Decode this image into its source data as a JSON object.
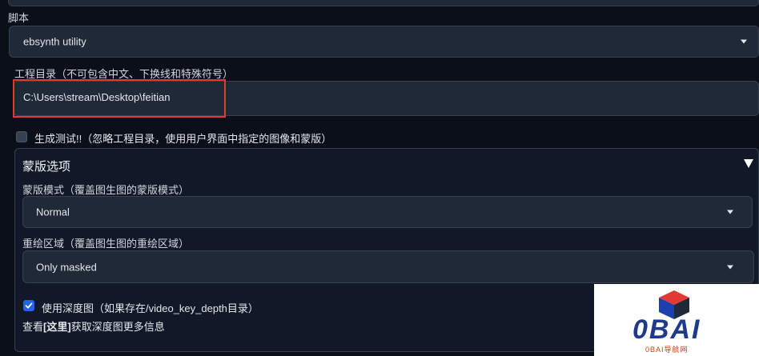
{
  "script": {
    "label": "脚本",
    "selected": "ebsynth utility"
  },
  "project_dir": {
    "label": "工程目录（不可包含中文、下换线和特殊符号）",
    "value": "C:\\Users\\stream\\Desktop\\feitian"
  },
  "generate_test": {
    "label": "生成测试!!（忽略工程目录，使用用户界面中指定的图像和蒙版）",
    "checked": false
  },
  "mask_options": {
    "title": "蒙版选项",
    "mask_mode": {
      "label": "蒙版模式（覆盖图生图的蒙版模式）",
      "selected": "Normal"
    },
    "inpaint_area": {
      "label": "重绘区域（覆盖图生图的重绘区域）",
      "selected": "Only masked"
    },
    "use_depth": {
      "label": "使用深度图（如果存在/video_key_depth目录）",
      "checked": true
    },
    "more_info": {
      "prefix": "查看",
      "link": "[这里]",
      "suffix": "获取深度图更多信息"
    }
  },
  "watermark": {
    "logo_text": "0BAI",
    "sub_text": "0BAI导航网"
  },
  "colors": {
    "accent_red": "#e53935",
    "checkbox_blue": "#2563eb",
    "logo_blue": "#1e40af"
  }
}
